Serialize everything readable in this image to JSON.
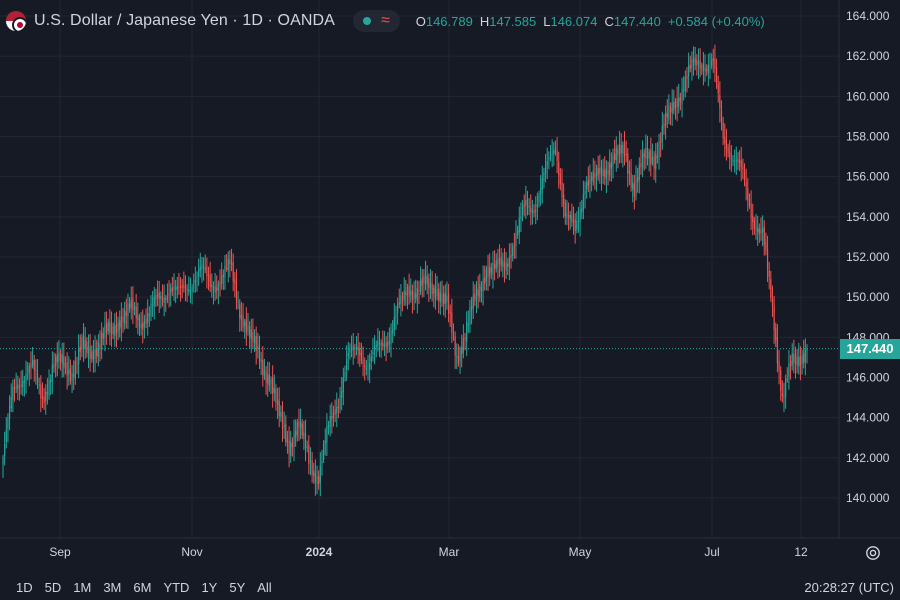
{
  "header": {
    "title": "U.S. Dollar / Japanese Yen · 1D · OANDA",
    "ohlc": [
      {
        "key": "O",
        "value": "146.789"
      },
      {
        "key": "H",
        "value": "147.585"
      },
      {
        "key": "L",
        "value": "146.074"
      },
      {
        "key": "C",
        "value": "147.440"
      }
    ],
    "change": "+0.584 (+0.40%)"
  },
  "icons": {
    "flag": "usd-jpy-flag-icon",
    "status": "market-open-dot-icon",
    "wave": "wave-icon",
    "settings": "gear-icon"
  },
  "colors": {
    "up": "#26a69a",
    "down": "#ef5350",
    "background": "#161a25",
    "grid": "#232733"
  },
  "chart_data": {
    "type": "candlestick",
    "ylim": [
      139,
      164.5
    ],
    "y_ticks": [
      "140.000",
      "142.000",
      "144.000",
      "146.000",
      "148.000",
      "150.000",
      "152.000",
      "154.000",
      "156.000",
      "158.000",
      "160.000",
      "162.000",
      "164.000"
    ],
    "x_ticks": [
      {
        "label": "Sep",
        "bold": false
      },
      {
        "label": "Nov",
        "bold": false
      },
      {
        "label": "2024",
        "bold": true
      },
      {
        "label": "Mar",
        "bold": false
      },
      {
        "label": "May",
        "bold": false
      },
      {
        "label": "Jul",
        "bold": false
      },
      {
        "label": "12",
        "bold": false
      }
    ],
    "last_price": "147.440",
    "path_knots": [
      [
        0,
        142.0
      ],
      [
        6,
        145.3
      ],
      [
        12,
        146.1
      ],
      [
        18,
        146.4
      ],
      [
        24,
        145.0
      ],
      [
        30,
        146.4
      ],
      [
        36,
        146.8
      ],
      [
        42,
        146.3
      ],
      [
        48,
        147.4
      ],
      [
        54,
        147.3
      ],
      [
        60,
        147.9
      ],
      [
        66,
        148.3
      ],
      [
        72,
        149.1
      ],
      [
        78,
        149.3
      ],
      [
        84,
        148.8
      ],
      [
        90,
        149.4
      ],
      [
        96,
        149.9
      ],
      [
        102,
        150.6
      ],
      [
        108,
        150.1
      ],
      [
        114,
        150.7
      ],
      [
        120,
        151.4
      ],
      [
        126,
        150.6
      ],
      [
        132,
        150.9
      ],
      [
        138,
        151.5
      ],
      [
        144,
        149.5
      ],
      [
        150,
        148.0
      ],
      [
        156,
        147.0
      ],
      [
        162,
        146.0
      ],
      [
        168,
        144.0
      ],
      [
        174,
        142.8
      ],
      [
        180,
        143.5
      ],
      [
        186,
        142.0
      ],
      [
        192,
        141.0
      ],
      [
        198,
        143.5
      ],
      [
        204,
        145.0
      ],
      [
        210,
        147.0
      ],
      [
        216,
        147.5
      ],
      [
        222,
        146.5
      ],
      [
        228,
        147.5
      ],
      [
        234,
        148.0
      ],
      [
        240,
        149.2
      ],
      [
        246,
        150.5
      ],
      [
        252,
        150.3
      ],
      [
        258,
        150.6
      ],
      [
        264,
        150.5
      ],
      [
        270,
        149.5
      ],
      [
        276,
        147.0
      ],
      [
        282,
        148.5
      ],
      [
        288,
        150.0
      ],
      [
        294,
        151.5
      ],
      [
        300,
        151.3
      ],
      [
        306,
        151.8
      ],
      [
        312,
        153.0
      ],
      [
        318,
        154.6
      ],
      [
        324,
        154.6
      ],
      [
        330,
        156.2
      ],
      [
        336,
        157.7
      ],
      [
        342,
        154.0
      ],
      [
        348,
        153.3
      ],
      [
        354,
        155.7
      ],
      [
        360,
        155.8
      ],
      [
        366,
        156.5
      ],
      [
        372,
        156.9
      ],
      [
        378,
        157.2
      ],
      [
        384,
        155.5
      ],
      [
        390,
        156.9
      ],
      [
        396,
        157.0
      ],
      [
        402,
        158.5
      ],
      [
        408,
        159.5
      ],
      [
        414,
        160.7
      ],
      [
        420,
        161.5
      ],
      [
        426,
        161.7
      ],
      [
        432,
        161.6
      ],
      [
        438,
        158.0
      ],
      [
        444,
        157.0
      ],
      [
        450,
        156.0
      ],
      [
        456,
        154.0
      ],
      [
        462,
        153.0
      ],
      [
        468,
        149.5
      ],
      [
        474,
        145.0
      ],
      [
        480,
        146.7
      ],
      [
        486,
        147.2
      ],
      [
        489,
        147.44
      ]
    ]
  },
  "toolbar": {
    "timeframes": [
      "1D",
      "5D",
      "1M",
      "3M",
      "6M",
      "YTD",
      "1Y",
      "5Y",
      "All"
    ]
  },
  "clock": "20:28:27 (UTC)"
}
